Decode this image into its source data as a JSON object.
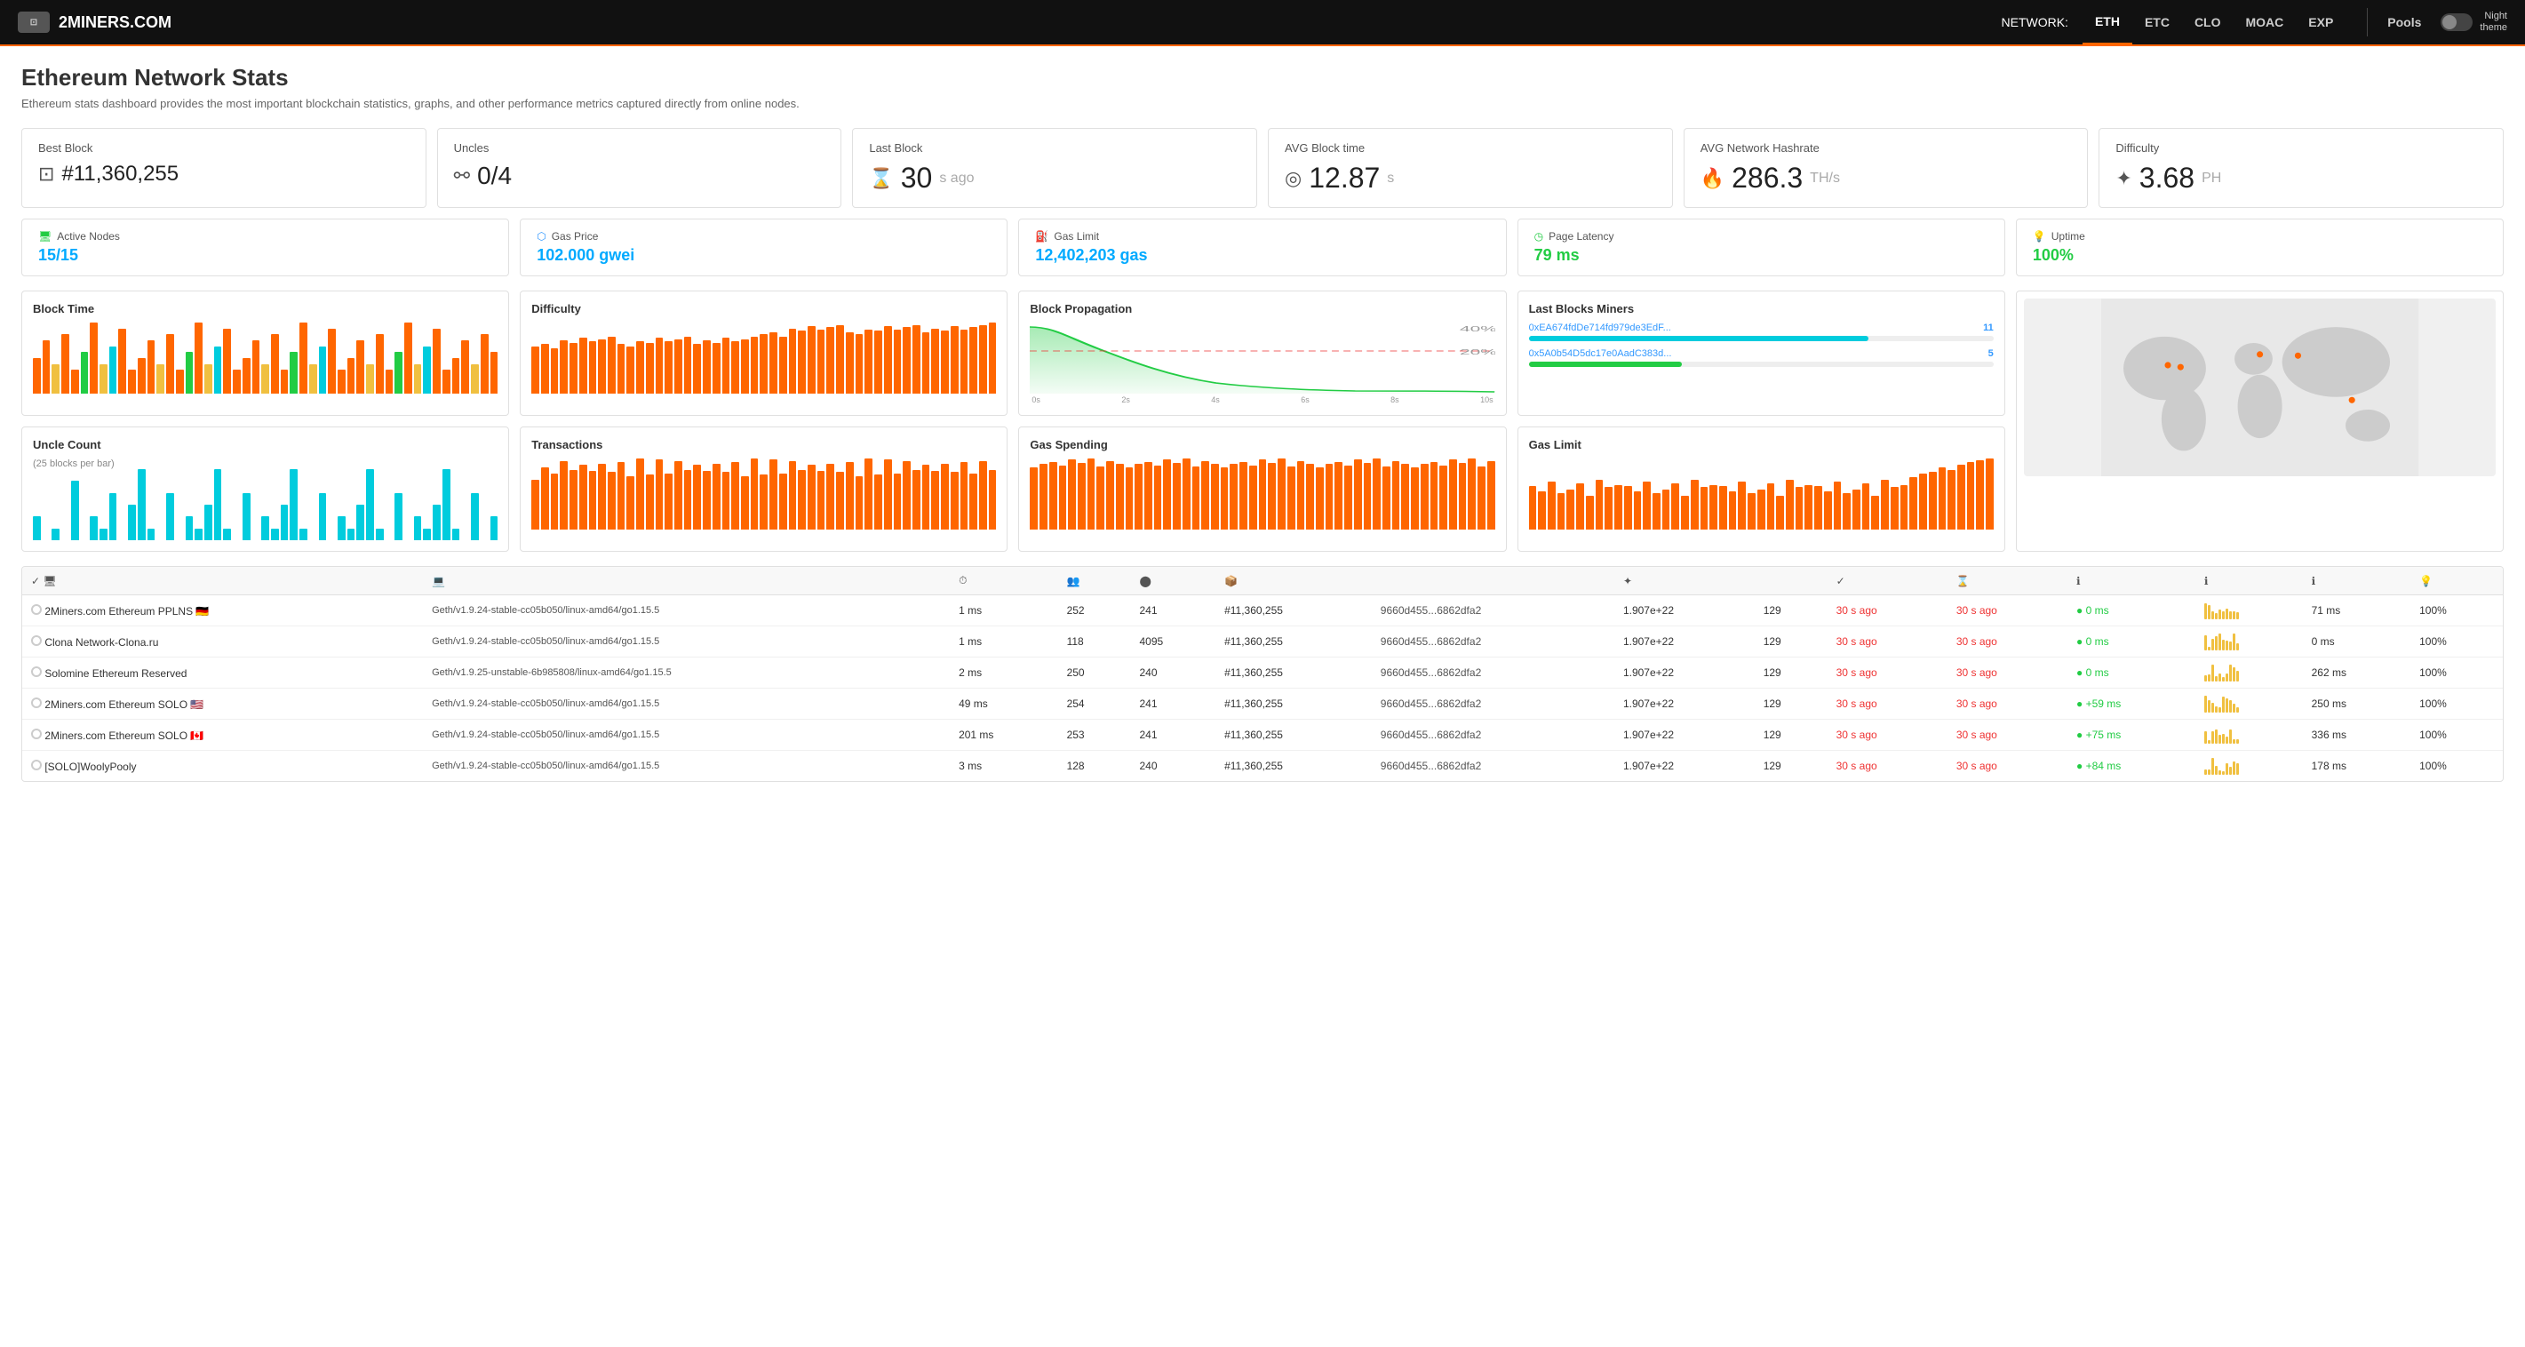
{
  "brand": {
    "name": "2MINERS.COM"
  },
  "nav": {
    "network_label": "NETWORK:",
    "links": [
      {
        "label": "ETH",
        "active": true
      },
      {
        "label": "ETC",
        "active": false
      },
      {
        "label": "CLO",
        "active": false
      },
      {
        "label": "MOAC",
        "active": false
      },
      {
        "label": "EXP",
        "active": false
      }
    ],
    "pools_label": "Pools",
    "night_theme_label": "Night\ntheme"
  },
  "page": {
    "title": "Ethereum Network Stats",
    "subtitle": "Ethereum stats dashboard provides the most important blockchain statistics, graphs, and other performance metrics captured directly from online nodes."
  },
  "stat_cards": [
    {
      "label": "Best Block",
      "icon": "□",
      "value": "#11,360,255",
      "unit": ""
    },
    {
      "label": "Uncles",
      "icon": "⚯",
      "value": "0/4",
      "unit": ""
    },
    {
      "label": "Last Block",
      "icon": "⌛",
      "value": "30",
      "unit": "s ago"
    },
    {
      "label": "AVG Block time",
      "icon": "◎",
      "value": "12.87",
      "unit": "s"
    },
    {
      "label": "AVG Network Hashrate",
      "icon": "🔥",
      "value": "286.3",
      "unit": "TH/s"
    },
    {
      "label": "Difficulty",
      "icon": "✦",
      "value": "3.68",
      "unit": "PH"
    }
  ],
  "stat_cards2": [
    {
      "label": "Active Nodes",
      "value": "15/15",
      "icon_type": "green"
    },
    {
      "label": "Gas Price",
      "value": "102.000 gwei",
      "icon_type": "blue"
    },
    {
      "label": "Gas Limit",
      "value": "12,402,203 gas",
      "icon_type": "blue"
    },
    {
      "label": "Page Latency",
      "value": "79 ms",
      "icon_type": "green"
    },
    {
      "label": "Uptime",
      "value": "100%",
      "icon_type": "green"
    }
  ],
  "charts": {
    "block_time": {
      "title": "Block Time",
      "bars": [
        30,
        45,
        25,
        50,
        20,
        35,
        60,
        25,
        40,
        55,
        20,
        30,
        45,
        25,
        50,
        20,
        35,
        60,
        25,
        40,
        55,
        20,
        30,
        45,
        25,
        50,
        20,
        35,
        60,
        25,
        40,
        55,
        20,
        30,
        45,
        25,
        50,
        20,
        35,
        60,
        25,
        40,
        55,
        20,
        30,
        45,
        25,
        50,
        35
      ],
      "colors": [
        "orange",
        "orange",
        "yellow",
        "orange",
        "orange",
        "green",
        "orange",
        "yellow",
        "cyan",
        "orange",
        "orange",
        "orange",
        "orange",
        "yellow",
        "orange",
        "orange",
        "green",
        "orange",
        "yellow",
        "cyan",
        "orange",
        "orange",
        "orange",
        "orange",
        "yellow",
        "orange",
        "orange",
        "green",
        "orange",
        "yellow",
        "cyan",
        "orange",
        "orange",
        "orange",
        "orange",
        "yellow",
        "orange",
        "orange",
        "green",
        "orange",
        "yellow",
        "cyan",
        "orange",
        "orange",
        "orange",
        "orange",
        "yellow",
        "orange",
        "orange"
      ]
    },
    "difficulty": {
      "title": "Difficulty",
      "bars": [
        40,
        42,
        38,
        45,
        43,
        47,
        44,
        46,
        48,
        42,
        40,
        44,
        43,
        47,
        44,
        46,
        48,
        42,
        45,
        43,
        47,
        44,
        46,
        48,
        50,
        52,
        48,
        55,
        53,
        57,
        54,
        56,
        58,
        52,
        50,
        54,
        53,
        57,
        54,
        56,
        58,
        52,
        55,
        53,
        57,
        54,
        56,
        58,
        60
      ],
      "color": "orange"
    },
    "block_propagation": {
      "title": "Block Propagation",
      "labels": [
        "0s",
        "2s",
        "4s",
        "6s",
        "8s",
        "10s"
      ],
      "percent_labels": [
        "40%",
        "20%"
      ],
      "curve_data": [
        100,
        80,
        40,
        20,
        10,
        5,
        3,
        2,
        1,
        1
      ]
    },
    "last_blocks_miners": {
      "title": "Last Blocks Miners",
      "miners": [
        {
          "addr": "0xEA674fdDe714fd979de3EdF...",
          "count": 11,
          "pct": 73,
          "color": "cyan"
        },
        {
          "addr": "0x5A0b54D5dc17e0AadC383d...",
          "count": 5,
          "pct": 33,
          "color": "green"
        }
      ]
    },
    "uncle_count": {
      "title": "Uncle Count",
      "subtitle": "(25 blocks per bar)",
      "bars": [
        10,
        0,
        5,
        0,
        25,
        0,
        10,
        5,
        20,
        0,
        15,
        30,
        5,
        0,
        20,
        0,
        10,
        5,
        15,
        30,
        5,
        0,
        20,
        0,
        10,
        5,
        15,
        30,
        5,
        0,
        20,
        0,
        10,
        5,
        15,
        30,
        5,
        0,
        20,
        0,
        10,
        5,
        15,
        30,
        5,
        0,
        20,
        0,
        10
      ],
      "color": "cyan"
    },
    "transactions": {
      "title": "Transactions",
      "bars": [
        40,
        50,
        45,
        55,
        48,
        52,
        47,
        53,
        46,
        54,
        43,
        57,
        44,
        56,
        45,
        55,
        48,
        52,
        47,
        53,
        46,
        54,
        43,
        57,
        44,
        56,
        45,
        55,
        48,
        52,
        47,
        53,
        46,
        54,
        43,
        57,
        44,
        56,
        45,
        55,
        48,
        52,
        47,
        53,
        46,
        54,
        45,
        55,
        48
      ],
      "color": "orange"
    },
    "gas_spending": {
      "title": "Gas Spending",
      "bars": [
        55,
        58,
        60,
        57,
        62,
        59,
        63,
        56,
        61,
        58,
        55,
        58,
        60,
        57,
        62,
        59,
        63,
        56,
        61,
        58,
        55,
        58,
        60,
        57,
        62,
        59,
        63,
        56,
        61,
        58,
        55,
        58,
        60,
        57,
        62,
        59,
        63,
        56,
        61,
        58,
        55,
        58,
        60,
        57,
        62,
        59,
        63,
        56,
        61
      ],
      "color": "orange"
    },
    "gas_limit": {
      "title": "Gas Limit",
      "bars": [
        45,
        40,
        50,
        38,
        42,
        48,
        35,
        52,
        44,
        46,
        45,
        40,
        50,
        38,
        42,
        48,
        35,
        52,
        44,
        46,
        45,
        40,
        50,
        38,
        42,
        48,
        35,
        52,
        44,
        46,
        45,
        40,
        50,
        38,
        42,
        48,
        35,
        52,
        44,
        46,
        55,
        58,
        60,
        65,
        62,
        68,
        70,
        72,
        74
      ],
      "color": "orange"
    }
  },
  "nodes": [
    {
      "name": "2Miners.com Ethereum PPLNS",
      "flag": "DE",
      "client": "Geth/v1.9.24-stable-cc05b050/linux-amd64/go1.15.5",
      "latency": "1 ms",
      "peers": "252",
      "pending": "241",
      "best_block": "#11,360,255",
      "block_hash": "9660d455...6862dfa2",
      "difficulty": "1.907e+22",
      "gas_price": "129",
      "last_block": "30 s ago",
      "propagation": "● 0 ms",
      "propagation_color": "green",
      "latency2": "71 ms",
      "uptime": "100%"
    },
    {
      "name": "Clona Network-Clona.ru",
      "flag": "",
      "client": "Geth/v1.9.24-stable-cc05b050/linux-amd64/go1.15.5",
      "latency": "1 ms",
      "peers": "118",
      "pending": "4095",
      "best_block": "#11,360,255",
      "block_hash": "9660d455...6862dfa2",
      "difficulty": "1.907e+22",
      "gas_price": "129",
      "last_block": "30 s ago",
      "propagation": "● 0 ms",
      "propagation_color": "green",
      "latency2": "0 ms",
      "uptime": "100%"
    },
    {
      "name": "Solomine Ethereum Reserved",
      "flag": "",
      "client": "Geth/v1.9.25-unstable-6b985808/linux-amd64/go1.15.5",
      "latency": "2 ms",
      "peers": "250",
      "pending": "240",
      "best_block": "#11,360,255",
      "block_hash": "9660d455...6862dfa2",
      "difficulty": "1.907e+22",
      "gas_price": "129",
      "last_block": "30 s ago",
      "propagation": "● 0 ms",
      "propagation_color": "green",
      "latency2": "262 ms",
      "uptime": "100%"
    },
    {
      "name": "2Miners.com Ethereum SOLO",
      "flag": "US",
      "client": "Geth/v1.9.24-stable-cc05b050/linux-amd64/go1.15.5",
      "latency": "49 ms",
      "peers": "254",
      "pending": "241",
      "best_block": "#11,360,255",
      "block_hash": "9660d455...6862dfa2",
      "difficulty": "1.907e+22",
      "gas_price": "129",
      "last_block": "30 s ago",
      "propagation": "+59 ms",
      "propagation_color": "green",
      "latency2": "250 ms",
      "uptime": "100%"
    },
    {
      "name": "2Miners.com Ethereum SOLO",
      "flag": "CA",
      "client": "Geth/v1.9.24-stable-cc05b050/linux-amd64/go1.15.5",
      "latency": "201 ms",
      "peers": "253",
      "pending": "241",
      "best_block": "#11,360,255",
      "block_hash": "9660d455...6862dfa2",
      "difficulty": "1.907e+22",
      "gas_price": "129",
      "last_block": "30 s ago",
      "propagation": "+75 ms",
      "propagation_color": "green",
      "latency2": "336 ms",
      "uptime": "100%"
    },
    {
      "name": "[SOLO]WoolyPooly",
      "flag": "",
      "client": "Geth/v1.9.24-stable-cc05b050/linux-amd64/go1.15.5",
      "latency": "3 ms",
      "peers": "128",
      "pending": "240",
      "best_block": "#11,360,255",
      "block_hash": "9660d455...6862dfa2",
      "difficulty": "1.907e+22",
      "gas_price": "129",
      "last_block": "30 s ago",
      "propagation": "+84 ms",
      "propagation_color": "green",
      "latency2": "178 ms",
      "uptime": "100%"
    }
  ],
  "table_headers": {
    "status": "✓ 🖥",
    "client": "💻",
    "latency": "⏱",
    "peers": "👥",
    "pending": "⬤",
    "best_block": "📦",
    "block_hash": "",
    "difficulty": "✦",
    "gas_price": "",
    "last_block": "✓",
    "last_block2": "⌛",
    "propagation": "ℹ",
    "sparkline": "ℹ",
    "latency2": "ℹ",
    "uptime": "💡"
  }
}
